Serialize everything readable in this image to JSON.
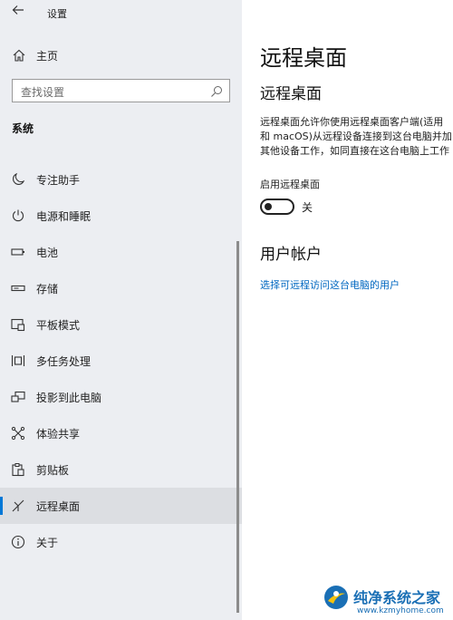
{
  "window": {
    "title": "设置"
  },
  "sidebar": {
    "home_label": "主页",
    "search_placeholder": "查找设置",
    "section_title": "系统",
    "items": [
      {
        "label": "专注助手",
        "icon": "moon-icon"
      },
      {
        "label": "电源和睡眠",
        "icon": "power-icon"
      },
      {
        "label": "电池",
        "icon": "battery-icon"
      },
      {
        "label": "存储",
        "icon": "storage-icon"
      },
      {
        "label": "平板模式",
        "icon": "tablet-mode-icon"
      },
      {
        "label": "多任务处理",
        "icon": "multitasking-icon"
      },
      {
        "label": "投影到此电脑",
        "icon": "project-icon"
      },
      {
        "label": "体验共享",
        "icon": "shared-experiences-icon"
      },
      {
        "label": "剪贴板",
        "icon": "clipboard-icon"
      },
      {
        "label": "远程桌面",
        "icon": "remote-desktop-icon",
        "selected": true
      },
      {
        "label": "关于",
        "icon": "info-icon"
      }
    ]
  },
  "main": {
    "page_title": "远程桌面",
    "sub_title": "远程桌面",
    "description_lines": [
      "远程桌面允许你使用远程桌面客户端(适用",
      "和 macOS)从远程设备连接到这台电脑并加",
      "其他设备工作，如同直接在这台电脑上工作"
    ],
    "toggle_label": "启用远程桌面",
    "toggle_state": "关",
    "toggle_on": false,
    "account_title": "用户帐户",
    "account_link": "选择可远程访问这台电脑的用户"
  },
  "watermark": {
    "title": "纯净系统之家",
    "url": "www.kzmyhome.com"
  },
  "colors": {
    "accent": "#0078d7",
    "link": "#0067c0",
    "sidebar_bg": "#eceef2",
    "selected_bg": "#dcdee2"
  }
}
